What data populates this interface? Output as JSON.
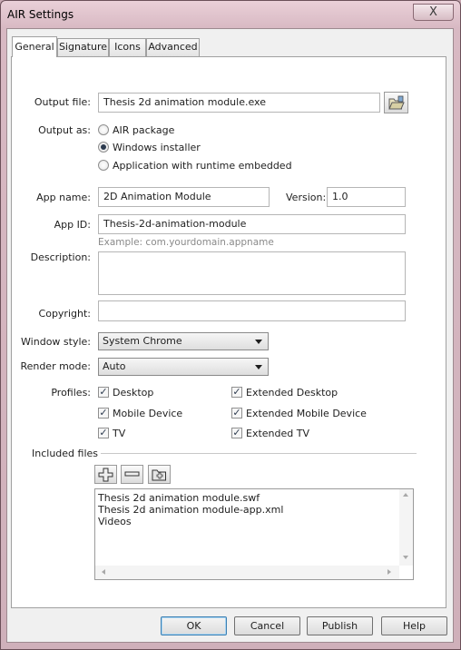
{
  "window": {
    "title": "AIR Settings",
    "close_glyph": "X"
  },
  "tabs": [
    {
      "label": "General",
      "active": true
    },
    {
      "label": "Signature",
      "active": false
    },
    {
      "label": "Icons",
      "active": false
    },
    {
      "label": "Advanced",
      "active": false
    }
  ],
  "output_file": {
    "label": "Output file:",
    "value": "Thesis 2d animation module.exe",
    "browse_icon": "folder-open-icon"
  },
  "output_as": {
    "label": "Output as:",
    "options": [
      {
        "label": "AIR package",
        "selected": false
      },
      {
        "label": "Windows installer",
        "selected": true
      },
      {
        "label": "Application with runtime embedded",
        "selected": false
      }
    ]
  },
  "app_name": {
    "label": "App name:",
    "value": "2D Animation Module"
  },
  "version": {
    "label": "Version:",
    "value": "1.0"
  },
  "app_id": {
    "label": "App ID:",
    "value": "Thesis-2d-animation-module",
    "hint": "Example: com.yourdomain.appname"
  },
  "description": {
    "label": "Description:",
    "value": ""
  },
  "copyright": {
    "label": "Copyright:",
    "value": ""
  },
  "window_style": {
    "label": "Window style:",
    "value": "System Chrome"
  },
  "render_mode": {
    "label": "Render mode:",
    "value": "Auto"
  },
  "profiles": {
    "label": "Profiles:",
    "items": [
      {
        "label": "Desktop",
        "checked": true
      },
      {
        "label": "Extended Desktop",
        "checked": true
      },
      {
        "label": "Mobile Device",
        "checked": true
      },
      {
        "label": "Extended Mobile Device",
        "checked": true
      },
      {
        "label": "TV",
        "checked": true
      },
      {
        "label": "Extended TV",
        "checked": true
      }
    ],
    "check_glyph": "✓"
  },
  "included_files": {
    "label": "Included files",
    "tools": [
      "add-file-icon",
      "remove-file-icon",
      "add-folder-icon"
    ],
    "files": [
      "Thesis 2d animation module.swf",
      "Thesis 2d animation module-app.xml",
      "Videos"
    ]
  },
  "buttons": {
    "ok": "OK",
    "cancel": "Cancel",
    "publish": "Publish",
    "help": "Help"
  }
}
